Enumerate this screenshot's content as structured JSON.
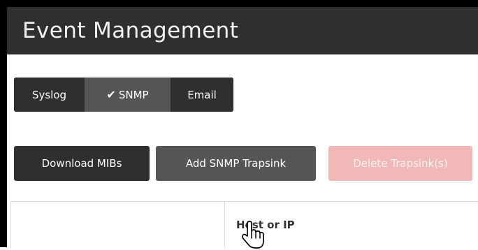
{
  "header": {
    "title": "Event Management"
  },
  "tabs": [
    {
      "label": "Syslog",
      "active": false
    },
    {
      "label": "SNMP",
      "active": true,
      "icon": "check-icon"
    },
    {
      "label": "Email",
      "active": false
    }
  ],
  "toolbar": {
    "download_label": "Download MIBs",
    "add_label": "Add SNMP Trapsink",
    "delete_label": "Delete Trapsink(s)"
  },
  "table": {
    "columns": [
      "",
      "Host or IP"
    ]
  },
  "colors": {
    "header_bg": "#2f2f2f",
    "active_tab_bg": "#555555",
    "delete_bg": "#f2b7b7"
  },
  "pointer": {
    "icon": "hand-cursor-icon"
  }
}
